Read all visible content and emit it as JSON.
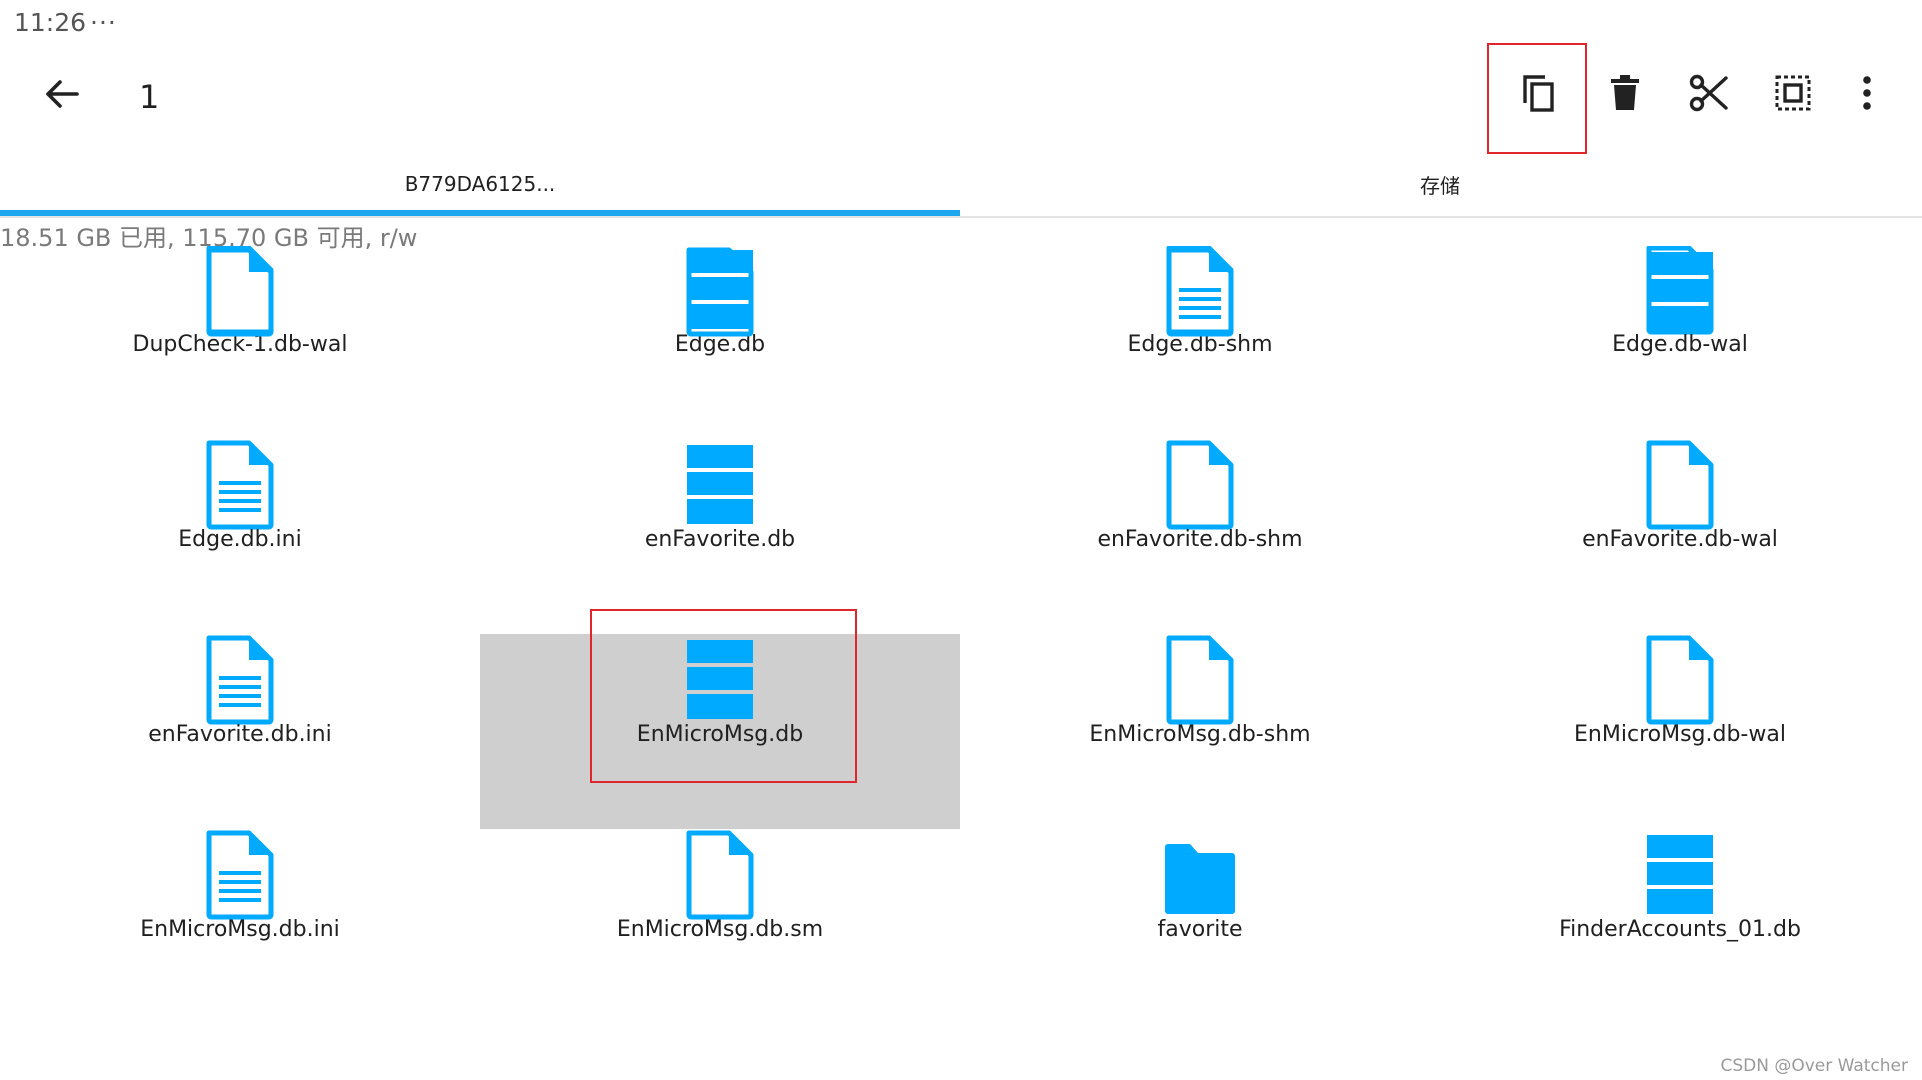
{
  "status_bar": {
    "time": "11:26",
    "more": "···"
  },
  "app_bar": {
    "back_icon": "arrow-left-icon",
    "title": "1",
    "actions": [
      {
        "name": "copy-button",
        "icon": "copy-icon"
      },
      {
        "name": "delete-button",
        "icon": "trash-icon"
      },
      {
        "name": "cut-button",
        "icon": "scissors-icon"
      },
      {
        "name": "select-all-button",
        "icon": "select-all-icon"
      },
      {
        "name": "more-options-button",
        "icon": "more-vertical-icon"
      }
    ]
  },
  "tabs": [
    {
      "label": "B779DA6125...",
      "active": true
    },
    {
      "label": "存储",
      "active": false
    }
  ],
  "storage_info": "18.51 GB 已用, 115.70 GB 可用, r/w",
  "accent_color": "#1ea7ee",
  "icon_color": "#00aaff",
  "highlight_color": "#e0252b",
  "files": [
    {
      "name": "DupCheck-1.db-wal",
      "icon": "file-icon"
    },
    {
      "name": "Edge.db",
      "icon": "database-icon"
    },
    {
      "name": "Edge.db-shm",
      "icon": "file-icon"
    },
    {
      "name": "Edge.db-wal",
      "icon": "file-icon"
    },
    {
      "name": "Edge.db.ini",
      "icon": "text-file-icon"
    },
    {
      "name": "enFavorite.db",
      "icon": "database-icon"
    },
    {
      "name": "enFavorite.db-shm",
      "icon": "file-icon"
    },
    {
      "name": "enFavorite.db-wal",
      "icon": "file-icon"
    },
    {
      "name": "enFavorite.db.ini",
      "icon": "text-file-icon"
    },
    {
      "name": "EnMicroMsg.db",
      "icon": "database-icon",
      "selected": true
    },
    {
      "name": "EnMicroMsg.db-shm",
      "icon": "file-icon"
    },
    {
      "name": "EnMicroMsg.db-wal",
      "icon": "file-icon"
    },
    {
      "name": "EnMicroMsg.db.ini",
      "icon": "text-file-icon"
    },
    {
      "name": "EnMicroMsg.db.sm",
      "icon": "file-icon"
    },
    {
      "name": "favorite",
      "icon": "folder-icon"
    },
    {
      "name": "FinderAccounts_01.db",
      "icon": "database-icon"
    },
    {
      "name": "",
      "icon": "file-icon"
    },
    {
      "name": "",
      "icon": "file-icon"
    },
    {
      "name": "",
      "icon": "text-file-icon"
    },
    {
      "name": "",
      "icon": "database-icon"
    }
  ],
  "watermark": "CSDN @Over Watcher"
}
